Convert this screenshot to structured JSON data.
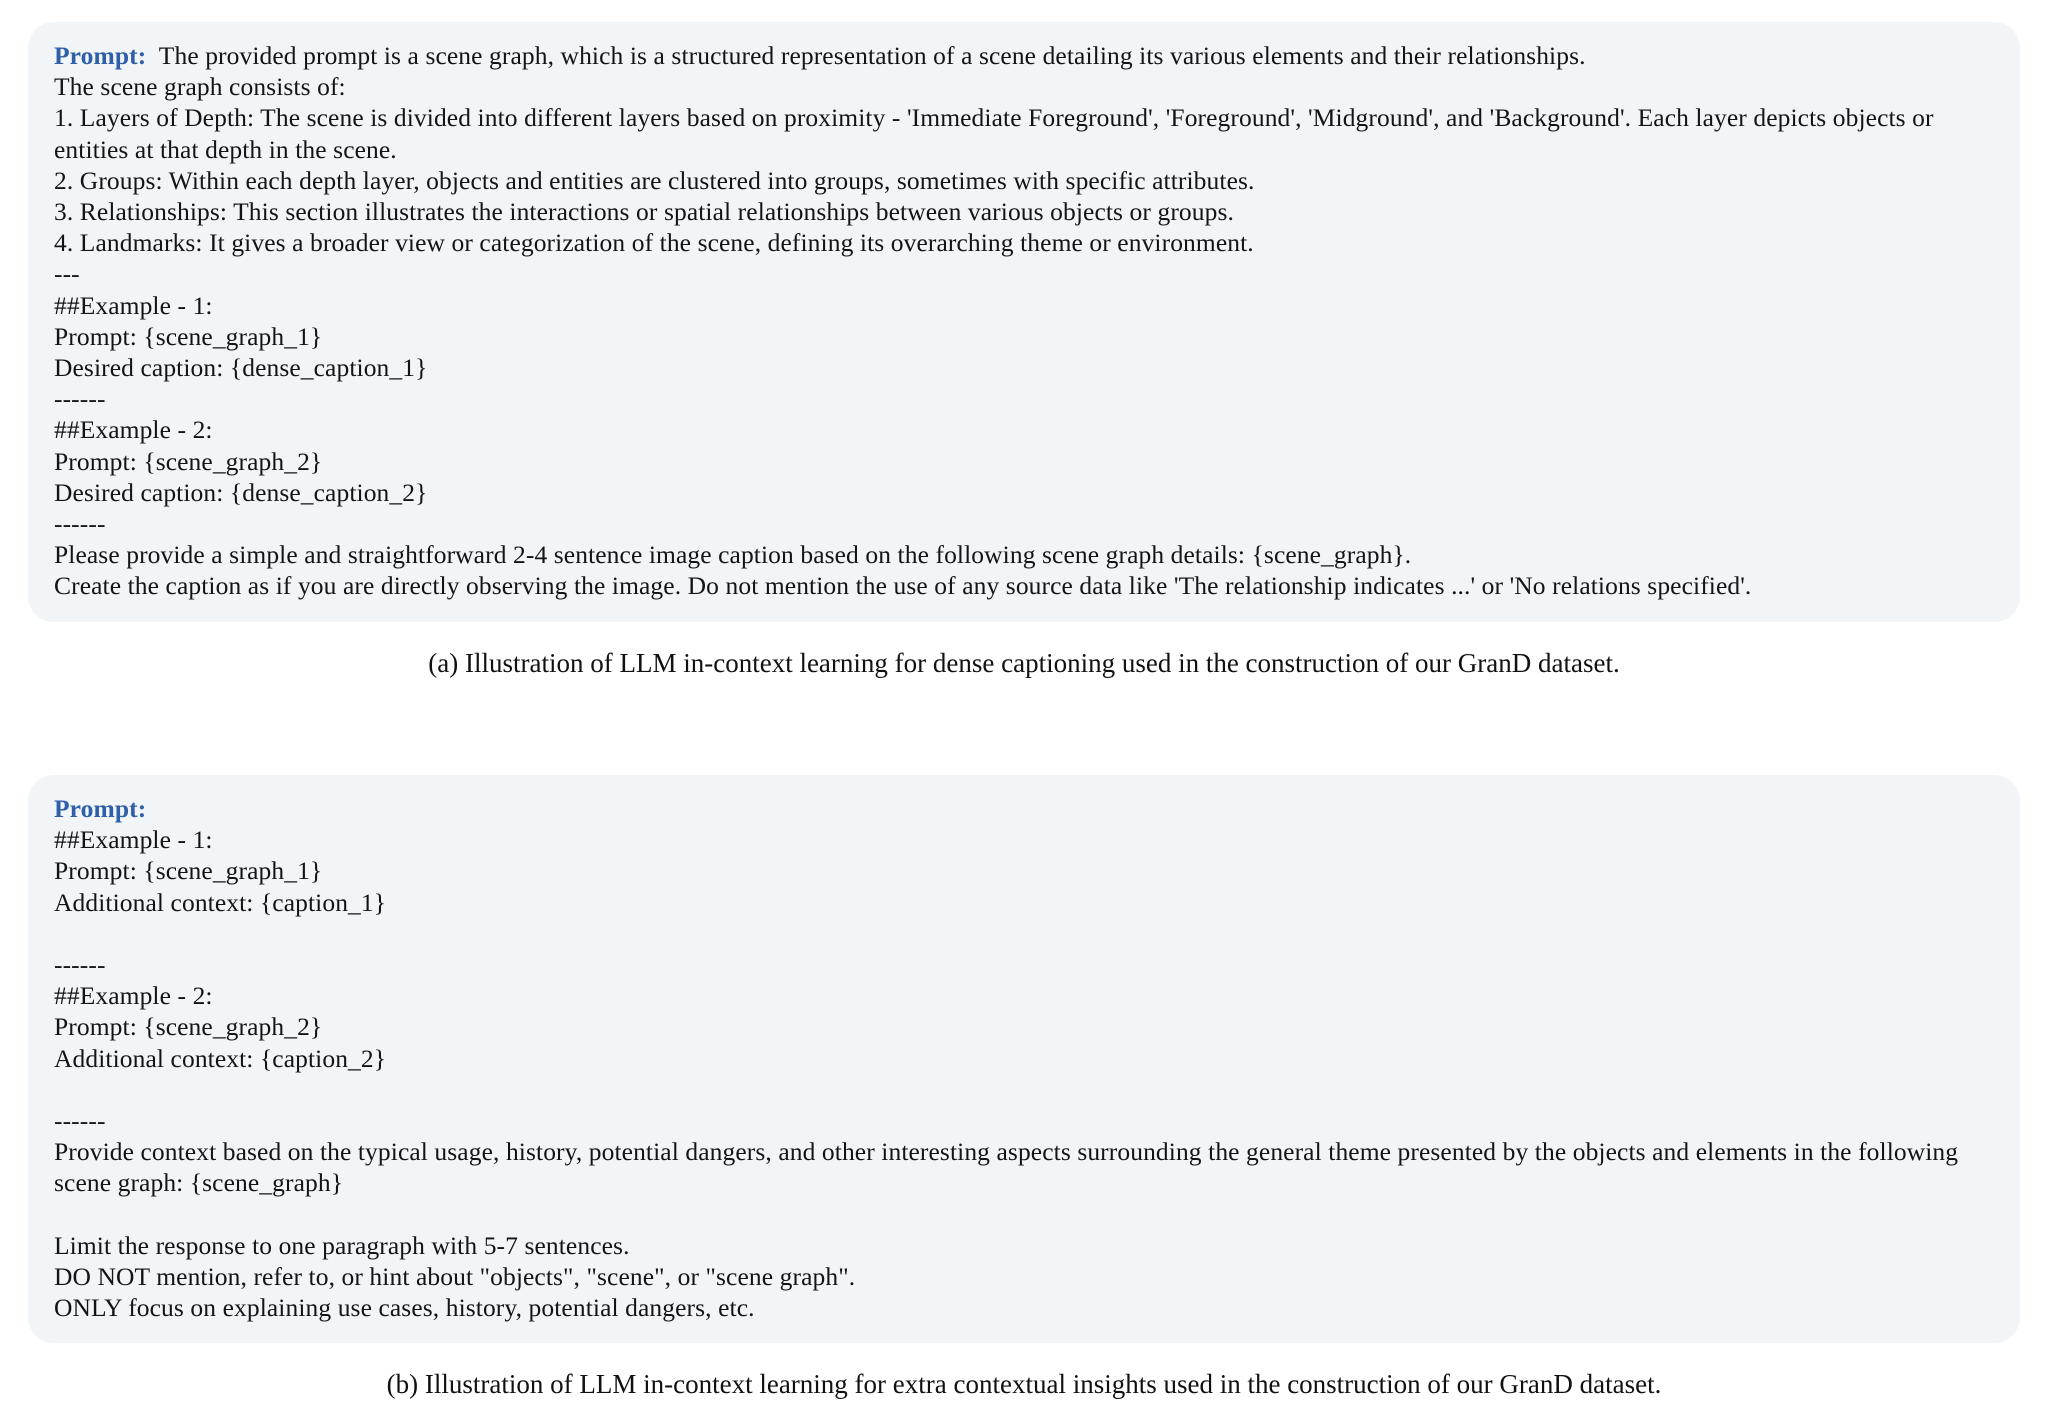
{
  "colors": {
    "prompt_label": "#2f5fa8",
    "box_background": "#f1f5f7",
    "page_background": "#ffffff",
    "text": "#141414"
  },
  "figure_a": {
    "prompt_label": "Prompt:",
    "first_line_rest": "The provided prompt is a scene graph, which is a structured representation of a scene detailing its various elements and their relationships.",
    "lines": [
      "The scene graph consists of:",
      "1. Layers of Depth: The scene is divided into different layers based on proximity - 'Immediate Foreground', 'Foreground', 'Midground', and 'Background'. Each layer depicts objects or entities at that depth in the scene.",
      "2. Groups: Within each depth layer, objects and entities are clustered into groups, sometimes with specific attributes.",
      "3. Relationships: This section illustrates the interactions or spatial relationships between various objects or groups.",
      "4. Landmarks: It gives a broader view or categorization of the scene, defining its overarching theme or environment.",
      "---",
      "##Example - 1:",
      "Prompt: {scene_graph_1}",
      "Desired caption: {dense_caption_1}",
      "------",
      "##Example - 2:",
      "Prompt: {scene_graph_2}",
      "Desired caption: {dense_caption_2}",
      "------",
      "Please provide a simple and straightforward 2-4 sentence image caption based on the following scene graph details: {scene_graph}.",
      "Create the caption as if you are directly observing the image. Do not mention the use of any source data like 'The relationship indicates ...' or 'No relations specified'."
    ],
    "caption": "(a) Illustration of LLM in-context learning for dense captioning used in the construction of our GranD dataset."
  },
  "figure_b": {
    "prompt_label": "Prompt:",
    "lines": [
      "##Example - 1:",
      "Prompt: {scene_graph_1}",
      "Additional context: {caption_1}",
      "",
      "------",
      "##Example - 2:",
      "Prompt: {scene_graph_2}",
      "Additional context: {caption_2}",
      "",
      "------",
      "Provide context based on the typical usage, history, potential dangers, and other interesting aspects surrounding the general theme presented by the objects and elements in the following scene graph: {scene_graph}",
      "",
      "Limit the response to one paragraph with 5-7 sentences.",
      "DO NOT mention, refer to, or hint about \"objects\", \"scene\", or \"scene graph\".",
      "ONLY focus on explaining use cases, history, potential dangers, etc."
    ],
    "caption": "(b) Illustration of LLM in-context learning for extra contextual insights used in the construction of our GranD dataset."
  }
}
